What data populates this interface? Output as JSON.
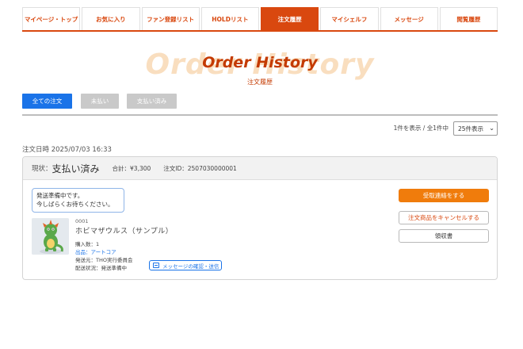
{
  "nav": {
    "tabs": [
      {
        "label": "マイページ・トップ",
        "active": false
      },
      {
        "label": "お気に入り",
        "active": false
      },
      {
        "label": "ファン登録リスト",
        "active": false
      },
      {
        "label": "HOLDリスト",
        "active": false
      },
      {
        "label": "注文履歴",
        "active": true
      },
      {
        "label": "マイシェルフ",
        "active": false
      },
      {
        "label": "メッセージ",
        "active": false
      },
      {
        "label": "閲覧履歴",
        "active": false
      }
    ],
    "accent_color": "#d9480f"
  },
  "hero": {
    "title": "Order History",
    "shadow": "Order History",
    "subtitle": "注文履歴"
  },
  "filters": {
    "all": "全ての注文",
    "unpaid": "未払い",
    "paid": "支払い済み",
    "active_color": "#1a73e8"
  },
  "pagination": {
    "count": "1件を表示 / 全1件中",
    "per_page": "25件表示"
  },
  "order": {
    "date": "注文日時 2025/07/03 16:33",
    "status_label": "現状：",
    "status_value": "支払い済み",
    "total": "合計：¥3,300",
    "order_id": "注文ID：2507030000001",
    "notice_line1": "発送準備中です。",
    "notice_line2": "今しばらくお待ちください。",
    "item": {
      "code": "0001",
      "name": "ホビマザウルス（サンプル）",
      "qty": "購入数：1",
      "shop_link": "出品：アートコア",
      "seller": "発送元：THO実行委員会",
      "shipping": "配送状況：発送準備中",
      "thumbnail_icon": "dinosaur-figure-image"
    },
    "message_button": "メッセージの確認・送信",
    "actions": {
      "receive": "受取連絡をする",
      "cancel": "注文商品をキャンセルする",
      "receipt": "領収書"
    }
  }
}
